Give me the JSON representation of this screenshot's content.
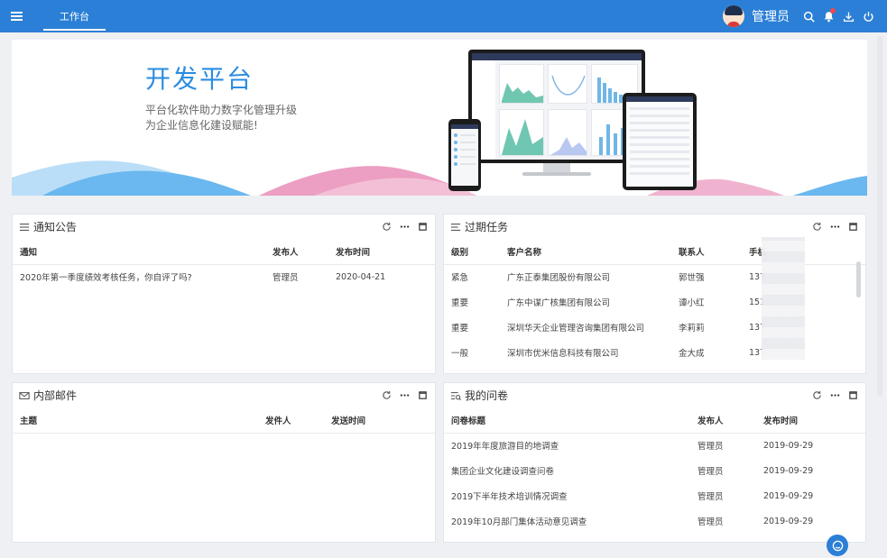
{
  "topbar": {
    "tab_label": "工作台",
    "username": "管理员"
  },
  "banner": {
    "title": "开发平台",
    "subtitle_line1": "平台化软件助力数字化管理升级",
    "subtitle_line2": "为企业信息化建设赋能!"
  },
  "notice": {
    "title": "通知公告",
    "columns": [
      "通知",
      "发布人",
      "发布时间"
    ],
    "rows": [
      [
        "2020年第一季度绩效考核任务，你自评了吗?",
        "管理员",
        "2020-04-21"
      ]
    ]
  },
  "tasks": {
    "title": "过期任务",
    "columns": [
      "级别",
      "客户名称",
      "联系人",
      "手机"
    ],
    "rows": [
      [
        "紧急",
        "广东正泰集团股份有限公司",
        "郭世强",
        "137"
      ],
      [
        "重要",
        "广东中谋广核集团有限公司",
        "谭小红",
        "151"
      ],
      [
        "重要",
        "深圳华天企业管理咨询集团有限公司",
        "李莉莉",
        "137"
      ],
      [
        "一般",
        "深圳市优米信息科技有限公司",
        "金大成",
        "137"
      ]
    ]
  },
  "mail": {
    "title": "内部邮件",
    "columns": [
      "主题",
      "发件人",
      "发送时间"
    ],
    "rows": []
  },
  "survey": {
    "title": "我的问卷",
    "columns": [
      "问卷标题",
      "发布人",
      "发布时间"
    ],
    "rows": [
      [
        "2019年年度旅游目的地调查",
        "管理员",
        "2019-09-29"
      ],
      [
        "集团企业文化建设调查问卷",
        "管理员",
        "2019-09-29"
      ],
      [
        "2019下半年技术培训情况调查",
        "管理员",
        "2019-09-29"
      ],
      [
        "2019年10月部门集体活动意见调查",
        "管理员",
        "2019-09-29"
      ]
    ]
  },
  "colors": {
    "primary": "#2b7fd6",
    "title_blue": "#2b8de0",
    "wave_blue": "#6ab8ef",
    "wave_pink": "#ec9fc2"
  }
}
